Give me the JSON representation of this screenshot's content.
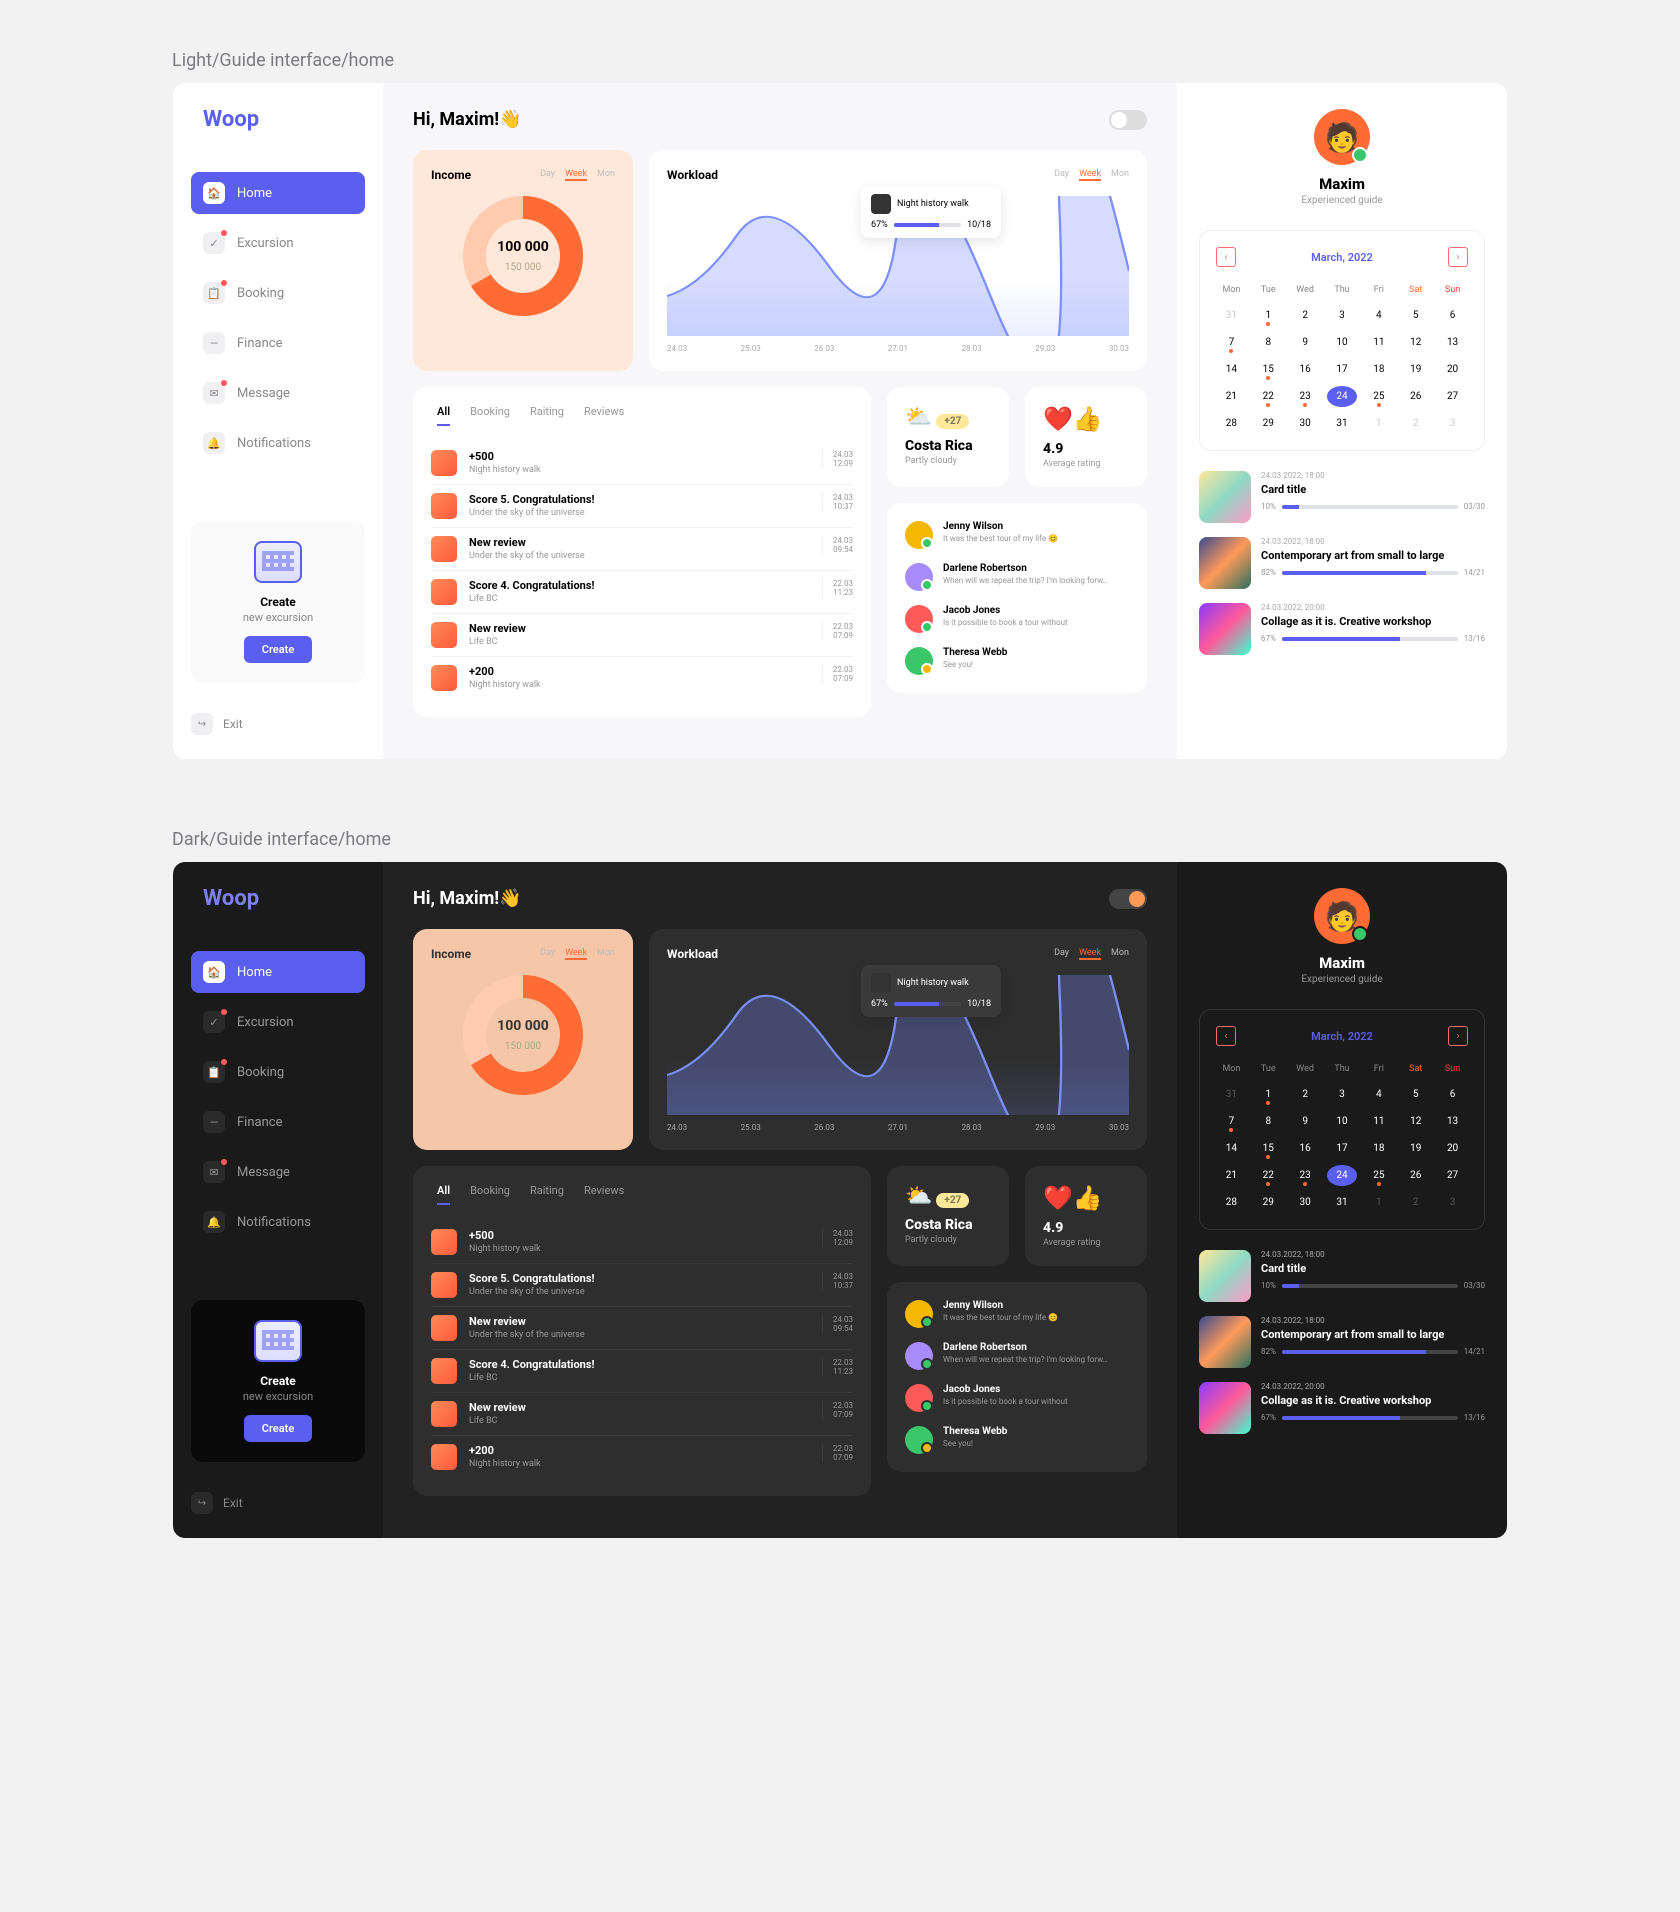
{
  "labels": {
    "light": "Light/Guide interface/home",
    "dark": "Dark/Guide interface/home"
  },
  "logo": "Woop",
  "nav": [
    {
      "label": "Home",
      "icon": "🏠",
      "active": true
    },
    {
      "label": "Excursion",
      "icon": "✓",
      "dot": true
    },
    {
      "label": "Booking",
      "icon": "📋",
      "dot": true
    },
    {
      "label": "Finance",
      "icon": "—"
    },
    {
      "label": "Message",
      "icon": "✉",
      "dot": true
    },
    {
      "label": "Notifications",
      "icon": "🔔"
    }
  ],
  "create": {
    "title": "Create",
    "sub": "new excursion",
    "btn": "Create"
  },
  "exit": "Exit",
  "greeting": "Hi, Maxim!👋",
  "income": {
    "title": "Income",
    "tabs": [
      "Day",
      "Week",
      "Mon"
    ],
    "active": 1,
    "value": "100 000",
    "total": "150 000"
  },
  "workload": {
    "title": "Workload",
    "tabs": [
      "Day",
      "Week",
      "Mon"
    ],
    "active": 1,
    "xaxis": [
      "24.03",
      "25.03",
      "26.03",
      "27.01",
      "28.03",
      "29.03",
      "30.03"
    ],
    "tooltip": {
      "title": "Night history walk",
      "pct": "67%",
      "count": "10/18"
    }
  },
  "feed": {
    "tabs": [
      "All",
      "Booking",
      "Raiting",
      "Reviews"
    ],
    "active": 0,
    "items": [
      {
        "title": "+500",
        "sub": "Night history walk",
        "date": "24.03",
        "time": "12:09"
      },
      {
        "title": "Score 5. Congratulations!",
        "sub": "Under the sky of the universe",
        "date": "24.03",
        "time": "10:37"
      },
      {
        "title": "New review",
        "sub": "Under the sky of the universe",
        "date": "24.03",
        "time": "09:54"
      },
      {
        "title": "Score 4. Congratulations!",
        "sub": "Life BC",
        "date": "22.03",
        "time": "11:23"
      },
      {
        "title": "New review",
        "sub": "Life BC",
        "date": "22.03",
        "time": "07:09"
      },
      {
        "title": "+200",
        "sub": "Night history walk",
        "date": "22.03",
        "time": "07:09"
      }
    ]
  },
  "weather": {
    "temp": "+27",
    "city": "Costa Rica",
    "desc": "Partly cloudy"
  },
  "rating": {
    "value": "4.9",
    "label": "Average rating"
  },
  "messages": [
    {
      "name": "Jenny Wilson",
      "txt": "It was the best tour of my life 😊",
      "color": "#f5b800",
      "status": "on"
    },
    {
      "name": "Darlene Robertson",
      "txt": "When will we repeat the trip? I'm looking forw…",
      "color": "#a78bfa",
      "status": "on"
    },
    {
      "name": "Jacob Jones",
      "txt": "Is it possible to book a tour without",
      "color": "#ff5a5a",
      "status": "on"
    },
    {
      "name": "Theresa Webb",
      "txt": "See you!",
      "color": "#3ac76a",
      "status": "off"
    }
  ],
  "profile": {
    "name": "Maxim",
    "role": "Experienced guide"
  },
  "calendar": {
    "month": "March, 2022",
    "dow": [
      "Mon",
      "Tue",
      "Wed",
      "Thu",
      "Fri",
      "Sat",
      "Sun"
    ],
    "days": [
      {
        "d": "31",
        "out": true
      },
      {
        "d": "1",
        "evt": true
      },
      {
        "d": "2"
      },
      {
        "d": "3"
      },
      {
        "d": "4"
      },
      {
        "d": "5"
      },
      {
        "d": "6"
      },
      {
        "d": "7",
        "evt": true
      },
      {
        "d": "8"
      },
      {
        "d": "9"
      },
      {
        "d": "10"
      },
      {
        "d": "11"
      },
      {
        "d": "12"
      },
      {
        "d": "13"
      },
      {
        "d": "14"
      },
      {
        "d": "15",
        "evt": true
      },
      {
        "d": "16"
      },
      {
        "d": "17"
      },
      {
        "d": "18"
      },
      {
        "d": "19"
      },
      {
        "d": "20"
      },
      {
        "d": "21"
      },
      {
        "d": "22",
        "evt": true
      },
      {
        "d": "23",
        "evt": true
      },
      {
        "d": "24",
        "today": true
      },
      {
        "d": "25",
        "evt": true
      },
      {
        "d": "26"
      },
      {
        "d": "27"
      },
      {
        "d": "28"
      },
      {
        "d": "29"
      },
      {
        "d": "30"
      },
      {
        "d": "31"
      },
      {
        "d": "1",
        "out": true
      },
      {
        "d": "2",
        "out": true
      },
      {
        "d": "3",
        "out": true
      }
    ]
  },
  "events": [
    {
      "date": "24.03.2022, 18:00",
      "title": "Card title",
      "pct": "10%",
      "count": "03/30",
      "fill": 10,
      "img": "linear-gradient(135deg,#ffe89a,#8fd9c4,#ff9ac4)"
    },
    {
      "date": "24.03.2022, 18:00",
      "title": "Contemporary art from small to large",
      "pct": "82%",
      "count": "14/21",
      "fill": 82,
      "img": "linear-gradient(135deg,#3a4a8f,#ff9a5a,#2a6f5f)"
    },
    {
      "date": "24.03.2022, 20:00",
      "title": "Collage as it is. Creative workshop",
      "pct": "67%",
      "count": "13/16",
      "fill": 67,
      "img": "linear-gradient(135deg,#8a3aff,#ff5a9a,#3affcf)"
    }
  ],
  "chart_data": {
    "type": "line",
    "categories": [
      "24.03",
      "25.03",
      "26.03",
      "27.01",
      "28.03",
      "29.03",
      "30.03"
    ],
    "values": [
      40,
      85,
      50,
      90,
      35,
      95,
      55
    ],
    "title": "Workload",
    "ylim": [
      0,
      100
    ]
  }
}
